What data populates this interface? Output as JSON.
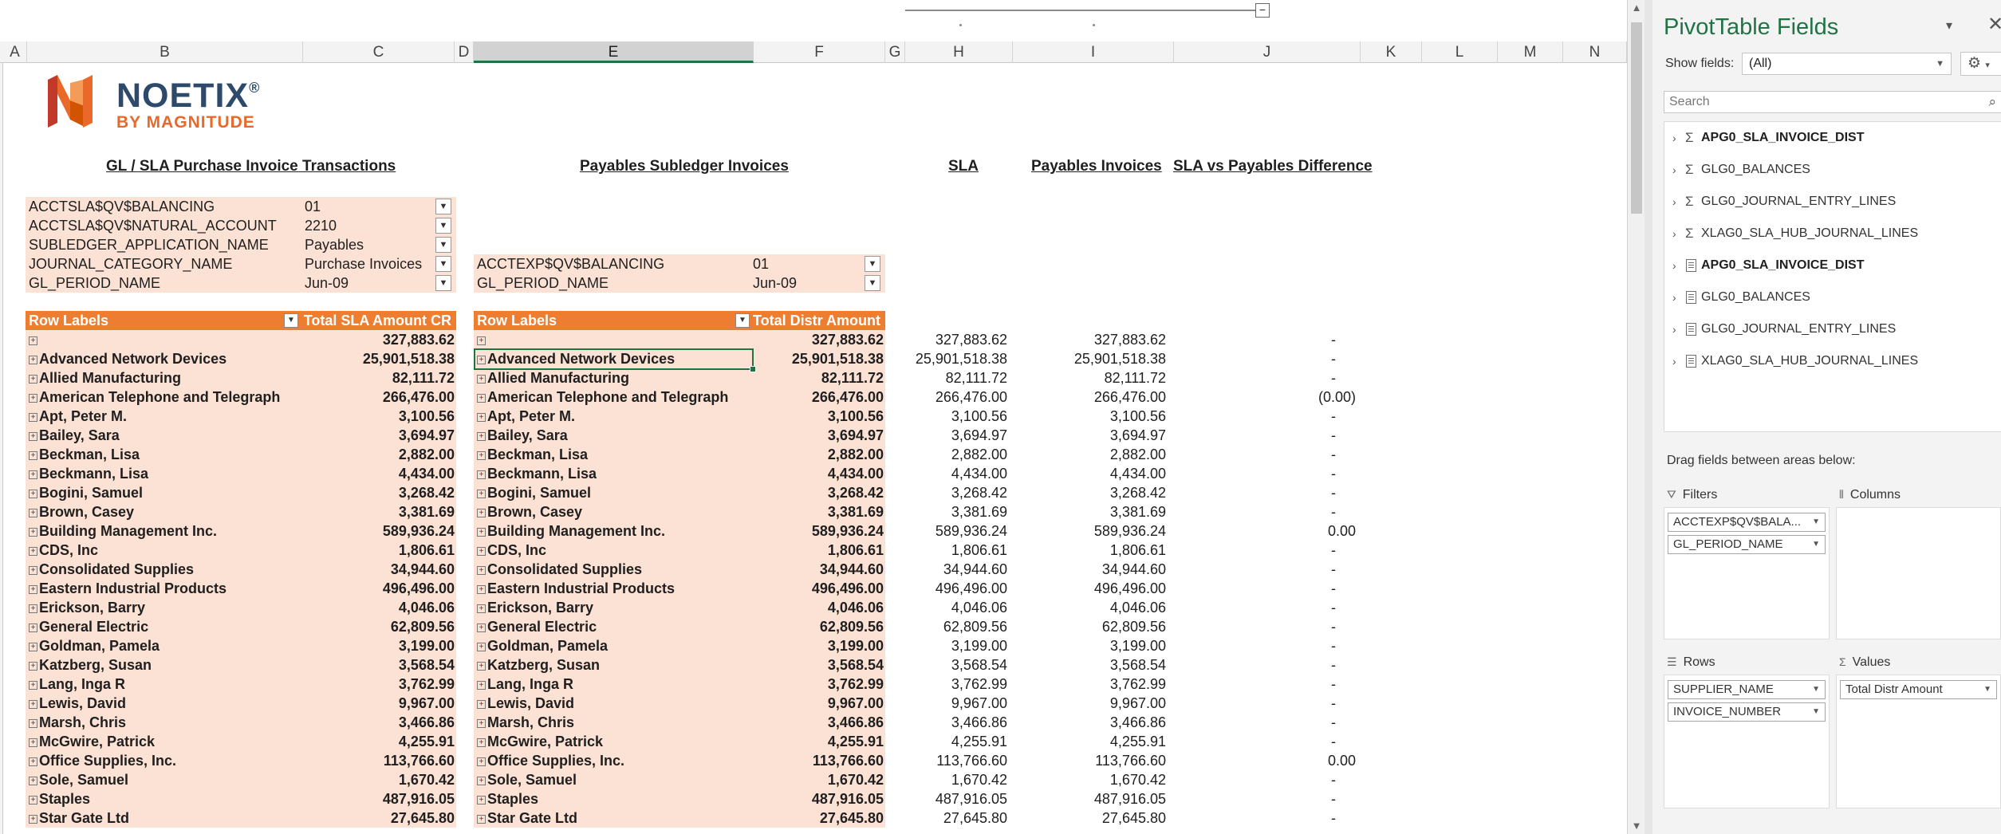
{
  "sheet": {
    "columns": [
      "A",
      "B",
      "C",
      "D",
      "E",
      "F",
      "G",
      "H",
      "I",
      "J",
      "K",
      "L",
      "M",
      "N"
    ],
    "logo": {
      "word": "NOETIX",
      "reg": "®",
      "sub": "BY MAGNITUDE",
      "colors": {
        "navy": "#2e4a6b",
        "orange": "#e8692a"
      }
    },
    "titles": {
      "gl": "GL / SLA Purchase Invoice Transactions",
      "payables": "Payables Subledger Invoices",
      "sla": "SLA",
      "payables_invoices": "Payables Invoices",
      "difference": "SLA vs Payables Difference"
    },
    "filters_left": [
      {
        "label": "ACCTSLA$QV$BALANCING",
        "value": "01"
      },
      {
        "label": "ACCTSLA$QV$NATURAL_ACCOUNT",
        "value": "2210"
      },
      {
        "label": "SUBLEDGER_APPLICATION_NAME",
        "value": "Payables"
      },
      {
        "label": "JOURNAL_CATEGORY_NAME",
        "value": "Purchase Invoices"
      },
      {
        "label": "GL_PERIOD_NAME",
        "value": "Jun-09"
      }
    ],
    "filters_right": [
      {
        "label": "ACCTEXP$QV$BALANCING",
        "value": "01"
      },
      {
        "label": "GL_PERIOD_NAME",
        "value": "Jun-09"
      }
    ],
    "pivot_left": {
      "row_labels": "Row Labels",
      "value_header": "Total SLA Amount CR"
    },
    "pivot_right": {
      "row_labels": "Row Labels",
      "value_header": "Total Distr Amount"
    },
    "rows": [
      {
        "name": "",
        "sla_cr": "327,883.62",
        "distr": "327,883.62",
        "sla": "327,883.62",
        "payables": "327,883.62",
        "diff": "-"
      },
      {
        "name": "Advanced Network Devices",
        "sla_cr": "25,901,518.38",
        "distr": "25,901,518.38",
        "sla": "25,901,518.38",
        "payables": "25,901,518.38",
        "diff": "-"
      },
      {
        "name": "Allied Manufacturing",
        "sla_cr": "82,111.72",
        "distr": "82,111.72",
        "sla": "82,111.72",
        "payables": "82,111.72",
        "diff": "-"
      },
      {
        "name": "American Telephone and Telegraph",
        "sla_cr": "266,476.00",
        "distr": "266,476.00",
        "sla": "266,476.00",
        "payables": "266,476.00",
        "diff": "(0.00)"
      },
      {
        "name": "Apt, Peter M.",
        "sla_cr": "3,100.56",
        "distr": "3,100.56",
        "sla": "3,100.56",
        "payables": "3,100.56",
        "diff": "-"
      },
      {
        "name": "Bailey, Sara",
        "sla_cr": "3,694.97",
        "distr": "3,694.97",
        "sla": "3,694.97",
        "payables": "3,694.97",
        "diff": "-"
      },
      {
        "name": "Beckman, Lisa",
        "sla_cr": "2,882.00",
        "distr": "2,882.00",
        "sla": "2,882.00",
        "payables": "2,882.00",
        "diff": "-"
      },
      {
        "name": "Beckmann, Lisa",
        "sla_cr": "4,434.00",
        "distr": "4,434.00",
        "sla": "4,434.00",
        "payables": "4,434.00",
        "diff": "-"
      },
      {
        "name": "Bogini, Samuel",
        "sla_cr": "3,268.42",
        "distr": "3,268.42",
        "sla": "3,268.42",
        "payables": "3,268.42",
        "diff": "-"
      },
      {
        "name": "Brown, Casey",
        "sla_cr": "3,381.69",
        "distr": "3,381.69",
        "sla": "3,381.69",
        "payables": "3,381.69",
        "diff": "-"
      },
      {
        "name": "Building Management Inc.",
        "sla_cr": "589,936.24",
        "distr": "589,936.24",
        "sla": "589,936.24",
        "payables": "589,936.24",
        "diff": "0.00"
      },
      {
        "name": "CDS, Inc",
        "sla_cr": "1,806.61",
        "distr": "1,806.61",
        "sla": "1,806.61",
        "payables": "1,806.61",
        "diff": "-"
      },
      {
        "name": "Consolidated Supplies",
        "sla_cr": "34,944.60",
        "distr": "34,944.60",
        "sla": "34,944.60",
        "payables": "34,944.60",
        "diff": "-"
      },
      {
        "name": "Eastern Industrial Products",
        "sla_cr": "496,496.00",
        "distr": "496,496.00",
        "sla": "496,496.00",
        "payables": "496,496.00",
        "diff": "-"
      },
      {
        "name": "Erickson, Barry",
        "sla_cr": "4,046.06",
        "distr": "4,046.06",
        "sla": "4,046.06",
        "payables": "4,046.06",
        "diff": "-"
      },
      {
        "name": "General Electric",
        "sla_cr": "62,809.56",
        "distr": "62,809.56",
        "sla": "62,809.56",
        "payables": "62,809.56",
        "diff": "-"
      },
      {
        "name": "Goldman, Pamela",
        "sla_cr": "3,199.00",
        "distr": "3,199.00",
        "sla": "3,199.00",
        "payables": "3,199.00",
        "diff": "-"
      },
      {
        "name": "Katzberg, Susan",
        "sla_cr": "3,568.54",
        "distr": "3,568.54",
        "sla": "3,568.54",
        "payables": "3,568.54",
        "diff": "-"
      },
      {
        "name": "Lang, Inga R",
        "sla_cr": "3,762.99",
        "distr": "3,762.99",
        "sla": "3,762.99",
        "payables": "3,762.99",
        "diff": "-"
      },
      {
        "name": "Lewis, David",
        "sla_cr": "9,967.00",
        "distr": "9,967.00",
        "sla": "9,967.00",
        "payables": "9,967.00",
        "diff": "-"
      },
      {
        "name": "Marsh, Chris",
        "sla_cr": "3,466.86",
        "distr": "3,466.86",
        "sla": "3,466.86",
        "payables": "3,466.86",
        "diff": "-"
      },
      {
        "name": "McGwire, Patrick",
        "sla_cr": "4,255.91",
        "distr": "4,255.91",
        "sla": "4,255.91",
        "payables": "4,255.91",
        "diff": "-"
      },
      {
        "name": "Office Supplies, Inc.",
        "sla_cr": "113,766.60",
        "distr": "113,766.60",
        "sla": "113,766.60",
        "payables": "113,766.60",
        "diff": "0.00"
      },
      {
        "name": "Sole, Samuel",
        "sla_cr": "1,670.42",
        "distr": "1,670.42",
        "sla": "1,670.42",
        "payables": "1,670.42",
        "diff": "-"
      },
      {
        "name": "Staples",
        "sla_cr": "487,916.05",
        "distr": "487,916.05",
        "sla": "487,916.05",
        "payables": "487,916.05",
        "diff": "-"
      },
      {
        "name": "Star Gate Ltd",
        "sla_cr": "27,645.80",
        "distr": "27,645.80",
        "sla": "27,645.80",
        "payables": "27,645.80",
        "diff": "-"
      }
    ]
  },
  "pane": {
    "title": "PivotTable Fields",
    "show_fields_label": "Show fields:",
    "show_fields_value": "(All)",
    "search_placeholder": "Search",
    "fields": [
      {
        "name": "APG0_SLA_INVOICE_DIST",
        "kind": "sigma",
        "bold": true
      },
      {
        "name": "GLG0_BALANCES",
        "kind": "sigma",
        "bold": false
      },
      {
        "name": "GLG0_JOURNAL_ENTRY_LINES",
        "kind": "sigma",
        "bold": false
      },
      {
        "name": "XLAG0_SLA_HUB_JOURNAL_LINES",
        "kind": "sigma",
        "bold": false
      },
      {
        "name": "APG0_SLA_INVOICE_DIST",
        "kind": "table",
        "bold": true
      },
      {
        "name": "GLG0_BALANCES",
        "kind": "table",
        "bold": false
      },
      {
        "name": "GLG0_JOURNAL_ENTRY_LINES",
        "kind": "table",
        "bold": false
      },
      {
        "name": "XLAG0_SLA_HUB_JOURNAL_LINES",
        "kind": "table",
        "bold": false
      }
    ],
    "drag_label": "Drag fields between areas below:",
    "areas": {
      "filters": {
        "title": "Filters",
        "items": [
          "ACCTEXP$QV$BALA...",
          "GL_PERIOD_NAME"
        ]
      },
      "columns": {
        "title": "Columns",
        "items": []
      },
      "rows": {
        "title": "Rows",
        "items": [
          "SUPPLIER_NAME",
          "INVOICE_NUMBER"
        ]
      },
      "values": {
        "title": "Values",
        "items": [
          "Total Distr Amount"
        ]
      }
    }
  }
}
